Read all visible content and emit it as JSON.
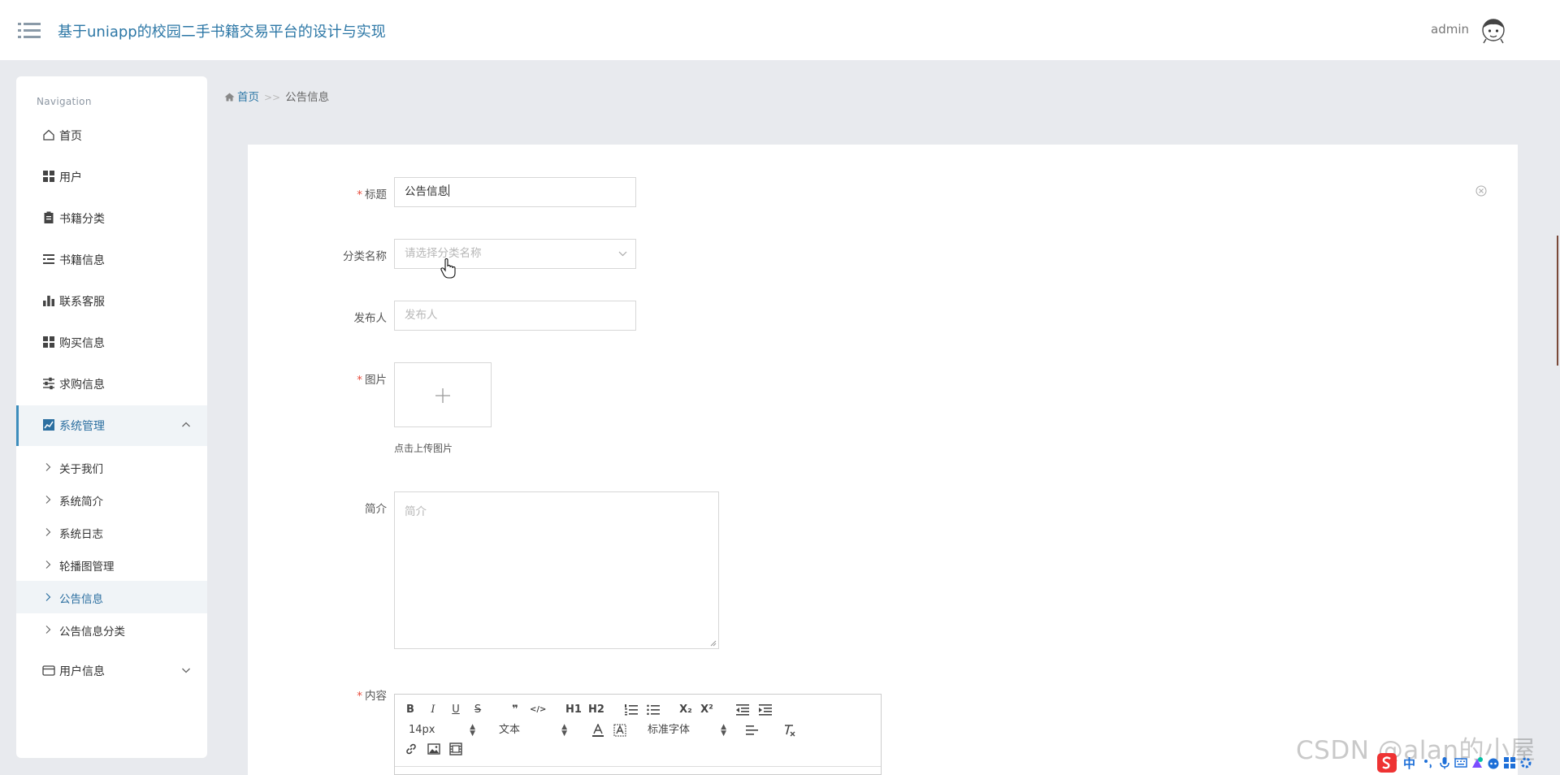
{
  "header": {
    "title": "基于uniapp的校园二手书籍交易平台的设计与实现",
    "user": "admin"
  },
  "sidebar": {
    "heading": "Navigation",
    "items": [
      {
        "label": "首页",
        "icon": "home-icon"
      },
      {
        "label": "用户",
        "icon": "grid-icon"
      },
      {
        "label": "书籍分类",
        "icon": "clipboard-icon"
      },
      {
        "label": "书籍信息",
        "icon": "list-icon"
      },
      {
        "label": "联系客服",
        "icon": "bar-chart-icon"
      },
      {
        "label": "购买信息",
        "icon": "grid-icon"
      },
      {
        "label": "求购信息",
        "icon": "sliders-icon"
      },
      {
        "label": "系统管理",
        "icon": "line-chart-icon",
        "expanded": true
      },
      {
        "label": "用户信息",
        "icon": "card-icon",
        "expanded": false
      }
    ],
    "sub_items": [
      "关于我们",
      "系统简介",
      "系统日志",
      "轮播图管理",
      "公告信息",
      "公告信息分类"
    ],
    "current_sub": "公告信息"
  },
  "breadcrumb": {
    "home": "首页",
    "separator": ">>",
    "current": "公告信息"
  },
  "form": {
    "title_label": "标题",
    "title_value": "公告信息",
    "category_label": "分类名称",
    "category_placeholder": "请选择分类名称",
    "publisher_label": "发布人",
    "publisher_placeholder": "发布人",
    "image_label": "图片",
    "image_hint": "点击上传图片",
    "intro_label": "简介",
    "intro_placeholder": "简介",
    "content_label": "内容",
    "required_mark": "*"
  },
  "editor_toolbar": {
    "row1": [
      "B",
      "I",
      "U",
      "S",
      "❞",
      "</>",
      "H1",
      "H2",
      "ordered-list",
      "bullet-list",
      "X₂",
      "X²",
      "outdent",
      "indent"
    ],
    "font_size": "14px",
    "paragraph": "文本",
    "font_family": "标准字体"
  },
  "watermark": "CSDN @alan的小屋",
  "tray": {
    "ime": "中"
  },
  "colors": {
    "accent": "#3c8dbc",
    "title": "#2c77a6",
    "required": "#e74c3c",
    "page_bg": "#e8eaee"
  }
}
